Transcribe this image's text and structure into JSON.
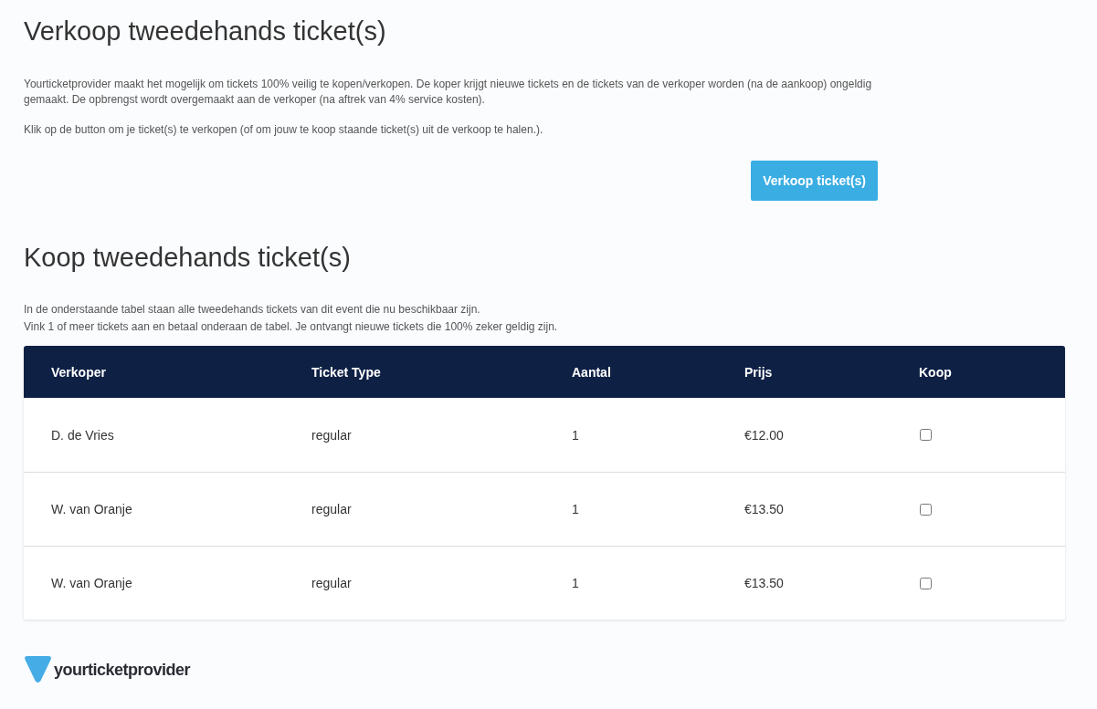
{
  "sell_section": {
    "title": "Verkoop tweedehands ticket(s)",
    "paragraphs": [
      "Yourticketprovider maakt het mogelijk om tickets 100% veilig te kopen/verkopen. De koper krijgt nieuwe tickets en de tickets van de verkoper worden (na de aankoop) ongeldig gemaakt. De opbrengst wordt overgemaakt aan de verkoper (na aftrek van 4% service kosten).",
      "Klik op de button om je ticket(s) te verkopen (of om jouw te koop staande ticket(s) uit de verkoop te halen.)."
    ],
    "button": "Verkoop ticket(s)"
  },
  "buy_section": {
    "title": "Koop tweedehands ticket(s)",
    "intro_lines": [
      "In de onderstaande tabel staan alle tweedehands tickets van dit event die nu beschikbaar zijn.",
      "Vink 1 of meer tickets aan en betaal onderaan de tabel. Je ontvangt nieuwe tickets die 100% zeker geldig zijn."
    ]
  },
  "table": {
    "columns": [
      "Verkoper",
      "Ticket Type",
      "Aantal",
      "Prijs",
      "Koop"
    ],
    "rows": [
      {
        "verkoper": "D. de Vries",
        "ticket_type": "regular",
        "aantal": "1",
        "prijs": "€12.00",
        "checked": false
      },
      {
        "verkoper": "W. van Oranje",
        "ticket_type": "regular",
        "aantal": "1",
        "prijs": "€13.50",
        "checked": false
      },
      {
        "verkoper": "W. van Oranje",
        "ticket_type": "regular",
        "aantal": "1",
        "prijs": "€13.50",
        "checked": false
      }
    ]
  },
  "footer": {
    "logo_text": "yourticketprovider"
  }
}
